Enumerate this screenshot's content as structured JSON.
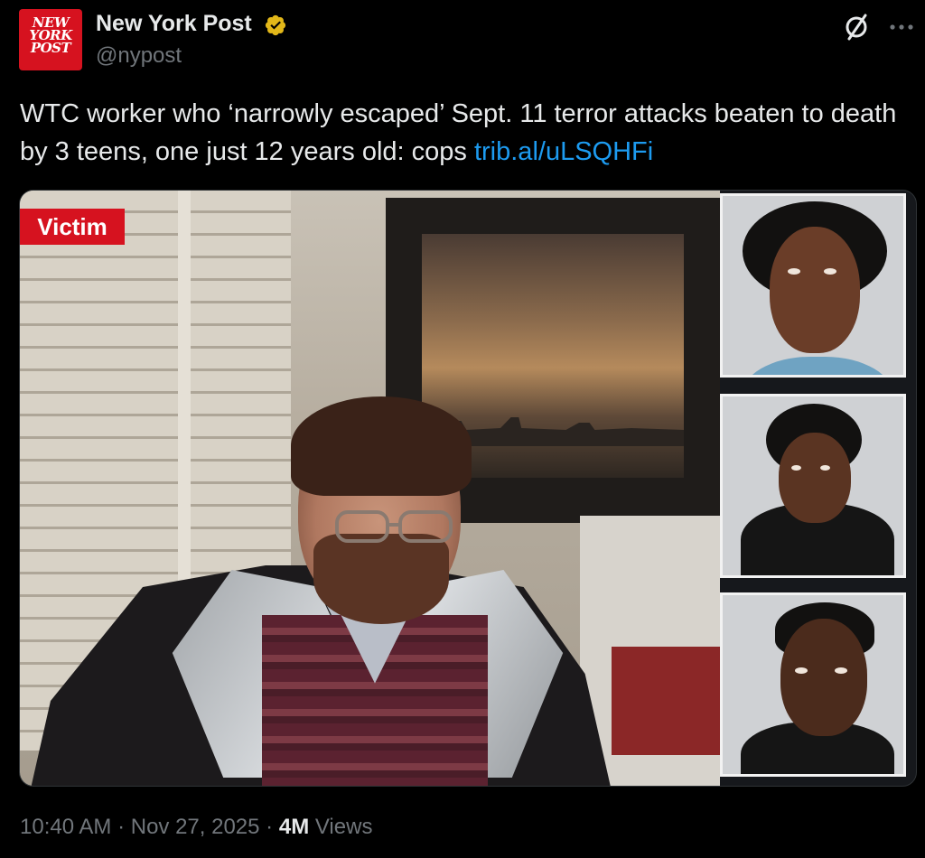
{
  "author": {
    "avatar_text_line1": "NEW",
    "avatar_text_line2": "YORK",
    "avatar_text_line3": "POST",
    "display_name": "New York Post",
    "handle": "@nypost",
    "verified_color": "#e2b719"
  },
  "icons": {
    "grok": "grok-icon",
    "more": "more-options-icon",
    "verified": "verified-badge-icon"
  },
  "tweet": {
    "text": "WTC worker who ‘narrowly escaped’ Sept. 11 terror attacks beaten to death by 3 teens, one just 12 years old: cops ",
    "link": "trib.al/uLSQHFi",
    "link_color": "#1d9bf0"
  },
  "media": {
    "badge_label": "Victim",
    "badge_color": "#d6121f"
  },
  "footer": {
    "time": "10:40 AM",
    "separator1": " · ",
    "date": "Nov 27, 2025",
    "separator2": " · ",
    "views_count": "4M",
    "views_label": " Views"
  }
}
